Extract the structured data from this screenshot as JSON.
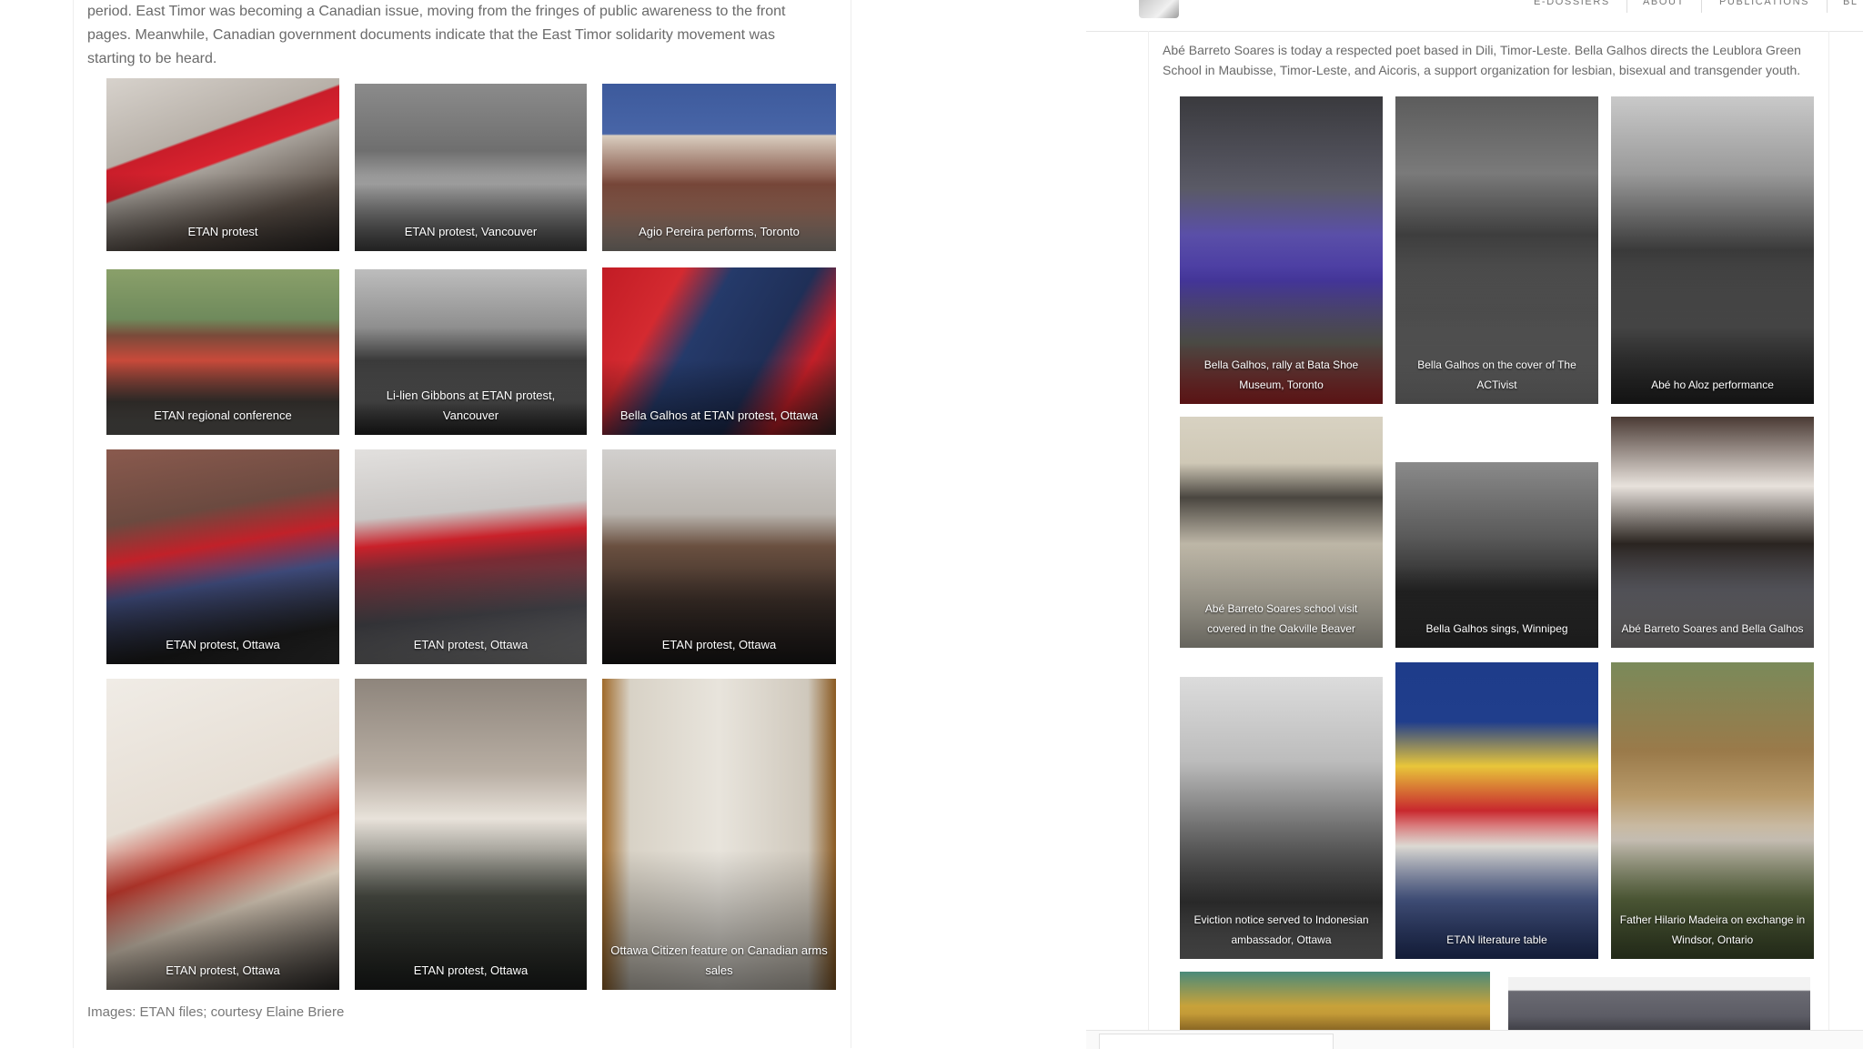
{
  "left": {
    "intro": "period. East Timor was becoming a Canadian issue, moving from the fringes of public awareness to the front pages. Meanwhile, Canadian government documents indicate that the East Timor solidarity movement was starting to be heard.",
    "credit": "Images: ETAN files; courtesy Elaine Briere",
    "gallery": [
      {
        "caption": "ETAN protest"
      },
      {
        "caption": "ETAN protest, Vancouver"
      },
      {
        "caption": "Agio Pereira performs, Toronto"
      },
      {
        "caption": "ETAN regional conference"
      },
      {
        "caption": "Li-lien Gibbons at ETAN protest, Vancouver"
      },
      {
        "caption": "Bella Galhos at ETAN protest, Ottawa"
      },
      {
        "caption": "ETAN protest, Ottawa"
      },
      {
        "caption": "ETAN protest, Ottawa"
      },
      {
        "caption": "ETAN protest, Ottawa"
      },
      {
        "caption": "ETAN protest, Ottawa"
      },
      {
        "caption": "ETAN protest, Ottawa"
      },
      {
        "caption": "Ottawa Citizen feature on Canadian arms sales"
      }
    ]
  },
  "right": {
    "nav": [
      "E-DOSSIERS",
      "ABOUT",
      "PUBLICATIONS",
      "BL"
    ],
    "intro": "Abé Barreto Soares is today a respected poet based in Dili, Timor-Leste. Bella Galhos directs the Leublora Green School in Maubisse, Timor-Leste, and Aicoris, a support organization for lesbian, bisexual and transgender youth.",
    "gallery": [
      {
        "caption": "Bella Galhos, rally at Bata Shoe Museum, Toronto"
      },
      {
        "caption": "Bella Galhos on the cover of The ACTivist"
      },
      {
        "caption": "Abé ho Aloz performance"
      },
      {
        "caption": "Abé Barreto Soares school visit covered in the Oakville Beaver"
      },
      {
        "caption": "Bella Galhos sings, Winnipeg"
      },
      {
        "caption": "Abé Barreto Soares and Bella Galhos"
      },
      {
        "caption": "Eviction notice served to Indonesian ambassador, Ottawa"
      },
      {
        "caption": "ETAN literature table"
      },
      {
        "caption": "Father Hilario Madeira on exchange in Windsor, Ontario"
      }
    ]
  }
}
